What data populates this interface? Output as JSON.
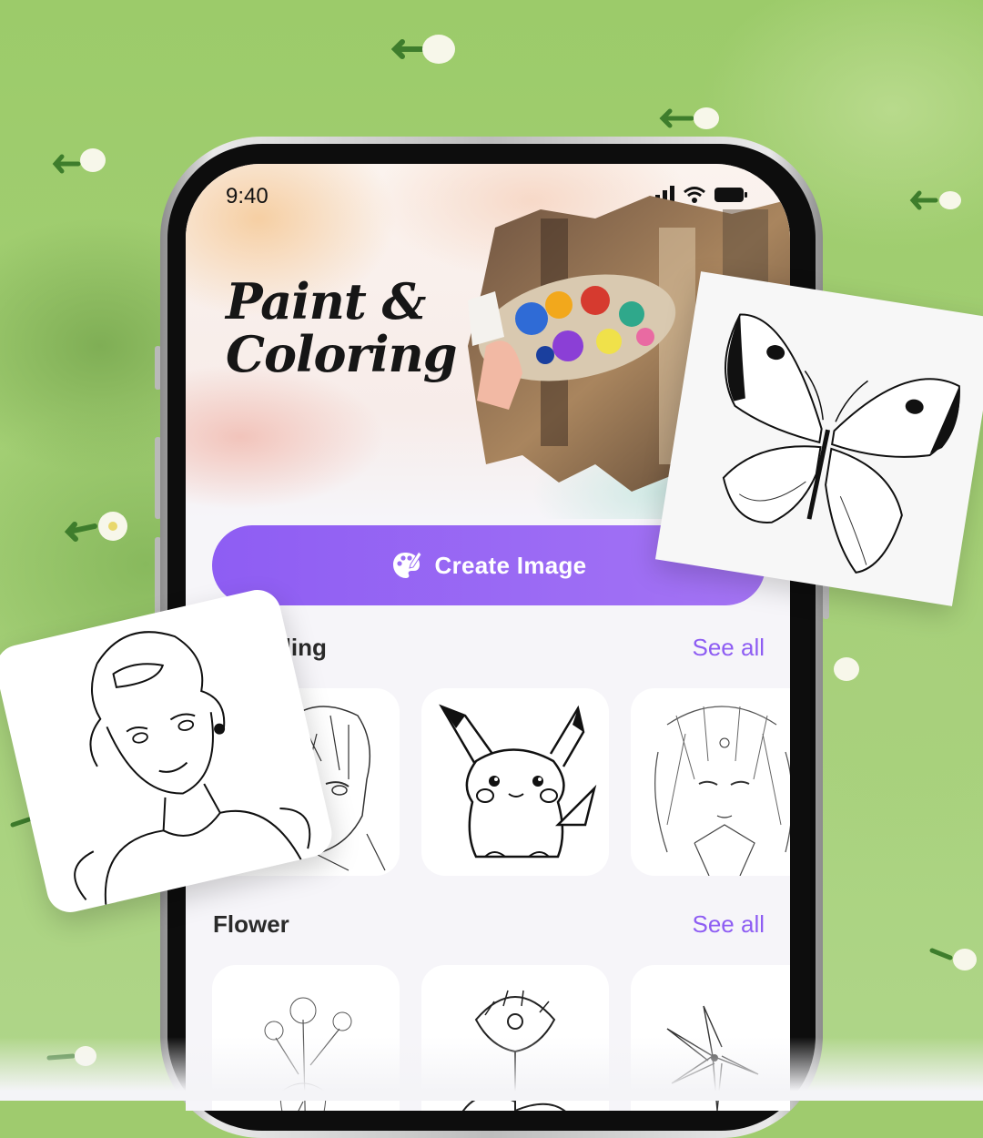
{
  "status_bar": {
    "time": "9:40"
  },
  "hero": {
    "title_line1": "Paint &",
    "title_line2": "Coloring"
  },
  "create_button": {
    "label": "Create Image",
    "icon": "palette-icon"
  },
  "sections": [
    {
      "title": "Trending",
      "visible_title": "ding",
      "see_all": "See all",
      "items": [
        "anime-boy-sketch",
        "pikachu-sketch",
        "anime-character-sketch"
      ]
    },
    {
      "title": "Flower",
      "see_all": "See all",
      "items": [
        "wildflower-sketch",
        "carnation-sketch",
        "lily-sketch"
      ]
    }
  ],
  "floating_cards": [
    "butterfly-sketch",
    "cinderella-sketch"
  ],
  "colors": {
    "accent": "#8e5df3",
    "background": "#9fcb6e",
    "screen": "#f6f5f9"
  }
}
